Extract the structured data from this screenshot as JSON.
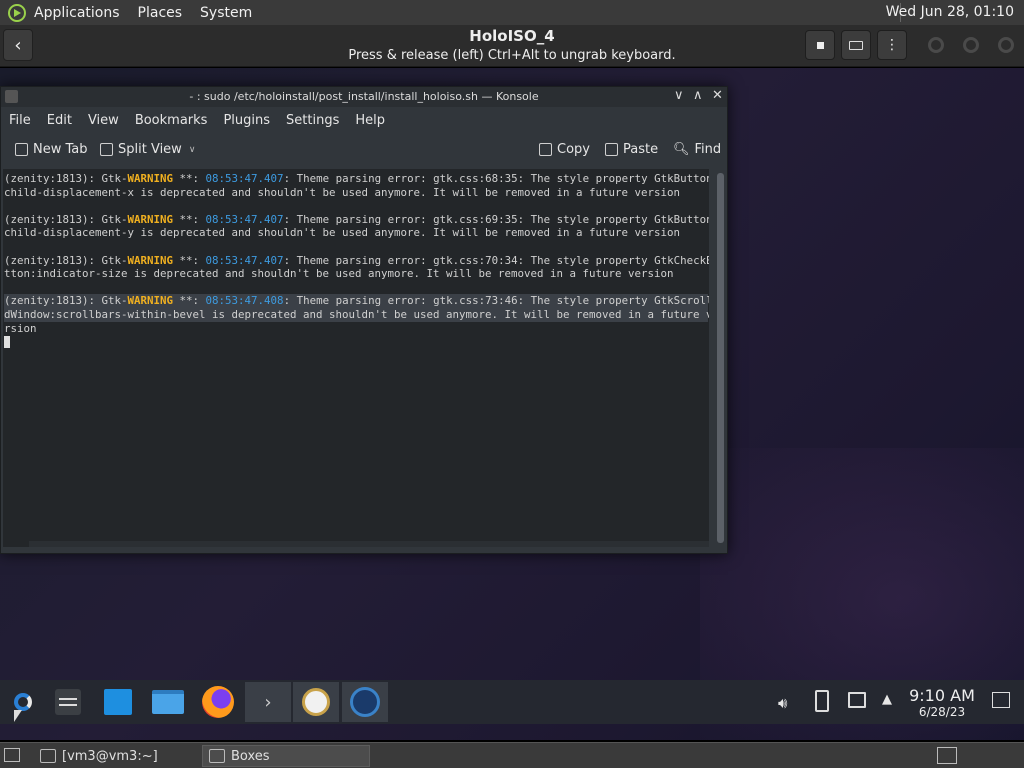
{
  "host_panel": {
    "menus": [
      "Applications",
      "Places",
      "System"
    ],
    "clock": "Wed Jun 28, 01:10"
  },
  "boxes": {
    "title": "HoloISO_4",
    "subtitle": "Press & release (left) Ctrl+Alt to ungrab keyboard.",
    "buttons": [
      "back-arrow-icon",
      "stop-icon",
      "keyboard-icon",
      "menu-kebab-icon"
    ]
  },
  "konsole": {
    "title": "- : sudo /etc/holoinstall/post_install/install_holoiso.sh — Konsole",
    "menus": [
      "File",
      "Edit",
      "View",
      "Bookmarks",
      "Plugins",
      "Settings",
      "Help"
    ],
    "toolbar": {
      "new_tab": "New Tab",
      "split_view": "Split View",
      "copy": "Copy",
      "paste": "Paste",
      "find": "Find"
    },
    "lines": [
      {
        "pre": "(zenity:1813): Gtk-",
        "warn": "WARNING",
        "mid": " **: ",
        "ts": "08:53:47.407",
        "post": ": Theme parsing error: gtk.css:68:35: The style property GtkButton:",
        "cont": "child-displacement-x is deprecated and shouldn't be used anymore. It will be removed in a future version"
      },
      {
        "pre": "(zenity:1813): Gtk-",
        "warn": "WARNING",
        "mid": " **: ",
        "ts": "08:53:47.407",
        "post": ": Theme parsing error: gtk.css:69:35: The style property GtkButton:",
        "cont": "child-displacement-y is deprecated and shouldn't be used anymore. It will be removed in a future version"
      },
      {
        "pre": "(zenity:1813): Gtk-",
        "warn": "WARNING",
        "mid": " **: ",
        "ts": "08:53:47.407",
        "post": ": Theme parsing error: gtk.css:70:34: The style property GtkCheckBu",
        "cont": "tton:indicator-size is deprecated and shouldn't be used anymore. It will be removed in a future version"
      },
      {
        "pre": "(zenity:1813): Gtk-",
        "warn": "WARNING",
        "mid": " **: ",
        "ts": "08:53:47.408",
        "post": ": Theme parsing error: gtk.css:73:46: The style property GtkScrolle",
        "cont": "dWindow:scrollbars-within-bevel is deprecated and shouldn't be used anymore. It will be removed in a future ve",
        "cont2": "rsion"
      }
    ]
  },
  "kde_panel": {
    "tasks": [
      "kde-launcher-icon",
      "settings-sliders-icon",
      "discover-store-icon",
      "file-manager-icon",
      "firefox-icon",
      "konsole-icon",
      "alarm-clock-icon",
      "steam-icon"
    ],
    "clock_time": "9:10 AM",
    "clock_date": "6/28/23"
  },
  "host_taskbar": {
    "items": [
      "[vm3@vm3:~]",
      "Boxes"
    ]
  },
  "colors": {
    "warning": "#f0b020",
    "timestamp": "#3d9be0",
    "terminal_bg": "#232629"
  }
}
